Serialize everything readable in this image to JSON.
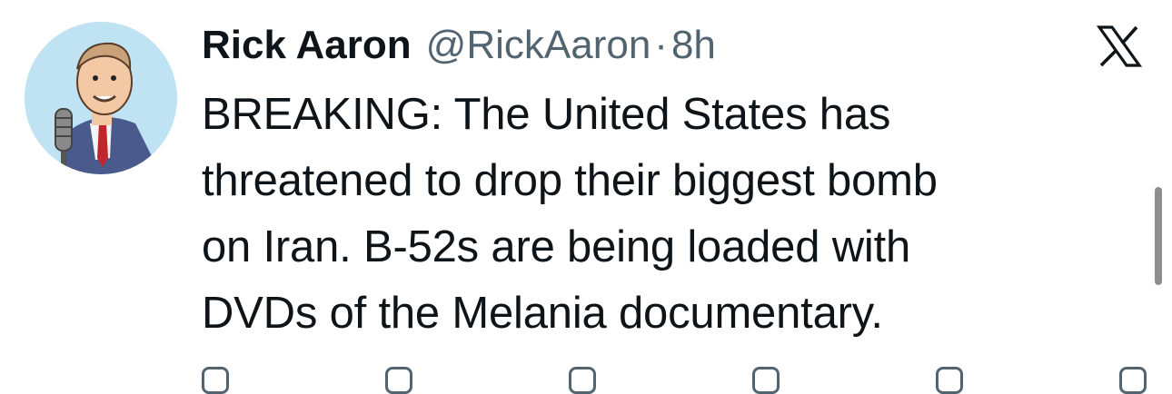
{
  "tweet": {
    "author": {
      "display_name": "Rick Aaron",
      "handle": "@RickAaron",
      "separator": "·",
      "time": "8h"
    },
    "text_lines": [
      "BREAKING: The United States has",
      "threatened to drop their biggest bomb",
      "on Iran. B-52s are being loaded with",
      "DVDs of the Melania documentary."
    ],
    "platform_icon": "x-logo-icon"
  },
  "colors": {
    "text_primary": "#0f1419",
    "text_secondary": "#536471",
    "background": "#ffffff",
    "scrollbar": "#8e8e8e"
  }
}
